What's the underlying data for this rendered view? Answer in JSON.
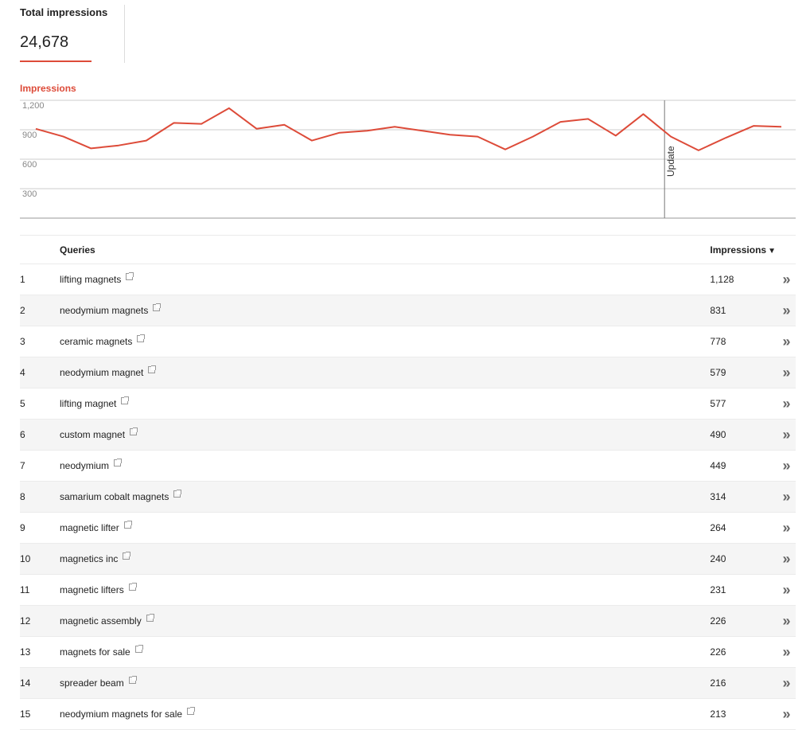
{
  "summary": {
    "label": "Total impressions",
    "value": "24,678"
  },
  "colors": {
    "accent": "#dd4b39",
    "grid": "#cccccc",
    "axis_text": "#888888"
  },
  "chart_data": {
    "type": "line",
    "title": "",
    "series_label": "Impressions",
    "ylim": [
      0,
      1200
    ],
    "yticks": [
      300,
      600,
      900,
      1200
    ],
    "ytick_labels": [
      "300",
      "600",
      "900",
      "1,200"
    ],
    "grid": true,
    "series": [
      {
        "name": "Impressions",
        "values": [
          910,
          830,
          710,
          740,
          790,
          970,
          960,
          1120,
          910,
          950,
          790,
          870,
          890,
          930,
          890,
          850,
          830,
          700,
          830,
          980,
          1010,
          840,
          1060,
          830,
          690,
          820,
          940,
          930
        ]
      }
    ],
    "annotations": [
      {
        "label": "Update",
        "index": 23
      }
    ]
  },
  "table": {
    "headers": {
      "rank": "",
      "query": "Queries",
      "impressions": "Impressions",
      "sort_indicator": "▼"
    },
    "more_icon": "double-chevron-right-icon",
    "rows": [
      {
        "rank": "1",
        "query": "lifting magnets",
        "impressions": "1,128"
      },
      {
        "rank": "2",
        "query": "neodymium magnets",
        "impressions": "831"
      },
      {
        "rank": "3",
        "query": "ceramic magnets",
        "impressions": "778"
      },
      {
        "rank": "4",
        "query": "neodymium magnet",
        "impressions": "579"
      },
      {
        "rank": "5",
        "query": "lifting magnet",
        "impressions": "577"
      },
      {
        "rank": "6",
        "query": "custom magnet",
        "impressions": "490"
      },
      {
        "rank": "7",
        "query": "neodymium",
        "impressions": "449"
      },
      {
        "rank": "8",
        "query": "samarium cobalt magnets",
        "impressions": "314"
      },
      {
        "rank": "9",
        "query": "magnetic lifter",
        "impressions": "264"
      },
      {
        "rank": "10",
        "query": "magnetics inc",
        "impressions": "240"
      },
      {
        "rank": "11",
        "query": "magnetic lifters",
        "impressions": "231"
      },
      {
        "rank": "12",
        "query": "magnetic assembly",
        "impressions": "226"
      },
      {
        "rank": "13",
        "query": "magnets for sale",
        "impressions": "226"
      },
      {
        "rank": "14",
        "query": "spreader beam",
        "impressions": "216"
      },
      {
        "rank": "15",
        "query": "neodymium magnets for sale",
        "impressions": "213"
      }
    ]
  }
}
